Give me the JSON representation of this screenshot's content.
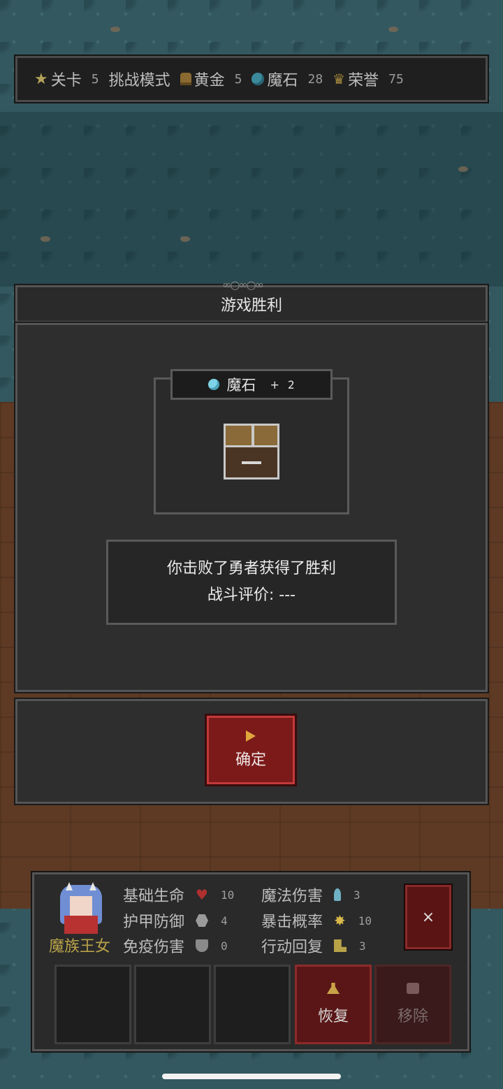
{
  "hud": {
    "level_label": "关卡",
    "level_value": "5",
    "mode": "挑战模式",
    "gold_label": "黄金",
    "gold_value": "5",
    "magic_stone_label": "魔石",
    "magic_stone_value": "28",
    "honor_label": "荣誉",
    "honor_value": "75"
  },
  "dialog": {
    "title": "游戏胜利",
    "reward": {
      "label": "魔石",
      "plus": "+",
      "amount": "2"
    },
    "message_line1": "你击败了勇者获得了胜利",
    "message_line2": "战斗评价: ---",
    "confirm_label": "确定"
  },
  "character": {
    "name": "魔族王女",
    "stats": [
      {
        "label": "基础生命",
        "value": "10",
        "icon": "heart-icon"
      },
      {
        "label": "护甲防御",
        "value": "4",
        "icon": "armor-icon"
      },
      {
        "label": "免疫伤害",
        "value": "0",
        "icon": "shield-icon"
      },
      {
        "label": "魔法伤害",
        "value": "3",
        "icon": "wand-icon"
      },
      {
        "label": "暴击概率",
        "value": "10",
        "icon": "sparkle-icon"
      },
      {
        "label": "行动回复",
        "value": "3",
        "icon": "boot-icon"
      }
    ],
    "close_label": "×",
    "restore_label": "恢复",
    "remove_label": "移除"
  },
  "colors": {
    "confirm_bg": "#7c1a1a",
    "name_gold": "#b8a248",
    "panel_bg": "#2e2e2e"
  }
}
